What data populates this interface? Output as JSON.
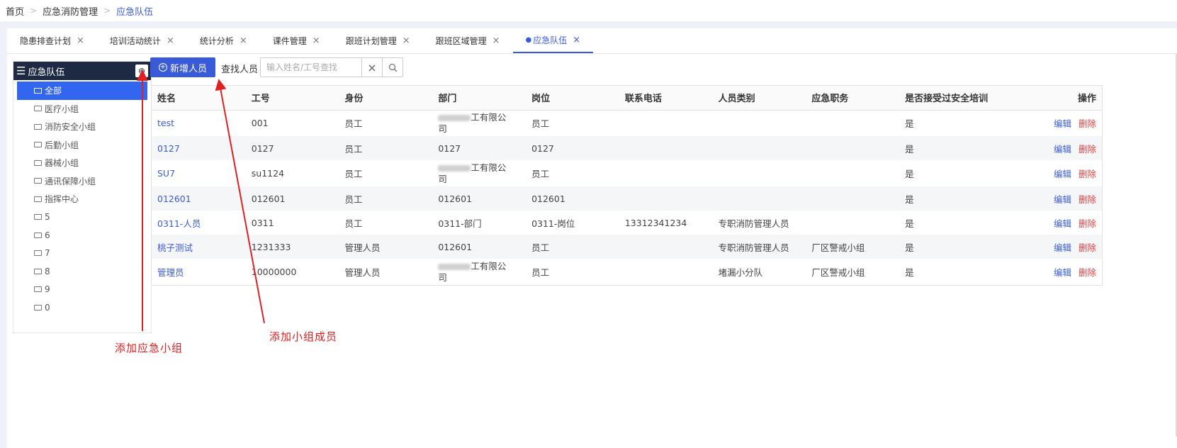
{
  "breadcrumb": [
    "首页",
    "应急消防管理",
    "应急队伍"
  ],
  "tabs": [
    {
      "label": "隐患排查计划"
    },
    {
      "label": "培训活动统计"
    },
    {
      "label": "统计分析"
    },
    {
      "label": "课件管理"
    },
    {
      "label": "跟班计划管理"
    },
    {
      "label": "跟班区域管理"
    },
    {
      "label": "应急队伍",
      "active": true
    }
  ],
  "tree": {
    "title": "应急队伍",
    "items": [
      "全部",
      "医疗小组",
      "消防安全小组",
      "后勤小组",
      "器械小组",
      "通讯保障小组",
      "指挥中心",
      "5",
      "6",
      "7",
      "8",
      "9",
      "0"
    ]
  },
  "toolbar": {
    "add_label": "新增人员",
    "search_label": "查找人员",
    "search_placeholder": "输入姓名/工号查找"
  },
  "table": {
    "columns": [
      "姓名",
      "工号",
      "身份",
      "部门",
      "岗位",
      "联系电话",
      "人员类别",
      "应急职务",
      "是否接受过安全培训",
      "操作"
    ],
    "edit_label": "编辑",
    "delete_label": "删除",
    "blurred_dept_suffix": "工有限公",
    "blurred_dept_line2": "司",
    "rows": [
      {
        "name": "test",
        "id": "001",
        "role": "员工",
        "dept": "",
        "post": "员工",
        "phone": "",
        "category": "",
        "duty": "",
        "trained": "是"
      },
      {
        "name": "0127",
        "id": "0127",
        "role": "员工",
        "dept": "0127",
        "post": "0127",
        "phone": "",
        "category": "",
        "duty": "",
        "trained": "是"
      },
      {
        "name": "SU7",
        "id": "su1124",
        "role": "员工",
        "dept": "",
        "post": "员工",
        "phone": "",
        "category": "",
        "duty": "",
        "trained": "是"
      },
      {
        "name": "012601",
        "id": "012601",
        "role": "员工",
        "dept": "012601",
        "post": "012601",
        "phone": "",
        "category": "",
        "duty": "",
        "trained": "是"
      },
      {
        "name": "0311-人员",
        "id": "0311",
        "role": "员工",
        "dept": "0311-部门",
        "post": "0311-岗位",
        "phone": "13312341234",
        "category": "专职消防管理人员",
        "duty": "",
        "trained": "是"
      },
      {
        "name": "桃子测试",
        "id": "1231333",
        "role": "管理人员",
        "dept": "012601",
        "post": "员工",
        "phone": "",
        "category": "专职消防管理人员",
        "duty": "厂区警戒小组",
        "trained": "是"
      },
      {
        "name": "管理员",
        "id": "10000000",
        "role": "管理人员",
        "dept": "",
        "post": "员工",
        "phone": "",
        "category": "堵漏小分队",
        "duty": "厂区警戒小组",
        "trained": "是"
      }
    ]
  },
  "annotations": {
    "add_group": "添加应急小组",
    "add_member": "添加小组成员"
  },
  "colors": {
    "accent": "#3a5bd9",
    "tree_header": "#1e2a44",
    "selected": "#3366ee",
    "delete": "#e04040",
    "annotation": "#e02020"
  }
}
